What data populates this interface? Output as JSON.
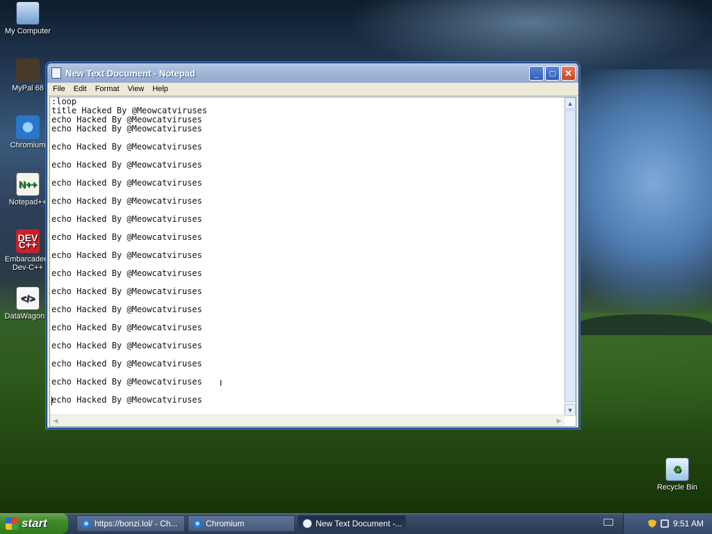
{
  "desktop": {
    "icons": [
      {
        "label": "My Computer",
        "glyph": ""
      },
      {
        "label": "MyPal 68",
        "glyph": ""
      },
      {
        "label": "Chromium",
        "glyph": ""
      },
      {
        "label": "Notepad++",
        "glyph": "N++"
      },
      {
        "label": "Embarcadero Dev-C++",
        "glyph": "DEV C++"
      },
      {
        "label": "DataWagon...",
        "glyph": "</>"
      },
      {
        "label": "Recycle Bin",
        "glyph": ""
      }
    ]
  },
  "window": {
    "title": "New Text Document - Notepad",
    "controls": {
      "minimize": "_",
      "maximize": "□",
      "close": "✕"
    },
    "menu": [
      "File",
      "Edit",
      "Format",
      "View",
      "Help"
    ],
    "content": ":loop\ntitle Hacked By @Meowcatviruses\necho Hacked By @Meowcatviruses\necho Hacked By @Meowcatviruses\n\necho Hacked By @Meowcatviruses\n\necho Hacked By @Meowcatviruses\n\necho Hacked By @Meowcatviruses\n\necho Hacked By @Meowcatviruses\n\necho Hacked By @Meowcatviruses\n\necho Hacked By @Meowcatviruses\n\necho Hacked By @Meowcatviruses\n\necho Hacked By @Meowcatviruses\n\necho Hacked By @Meowcatviruses\n\necho Hacked By @Meowcatviruses\n\necho Hacked By @Meowcatviruses\n\necho Hacked By @Meowcatviruses\n\necho Hacked By @Meowcatviruses\n\necho Hacked By @Meowcatviruses\n\necho Hacked By @Meowcatviruses\n"
  },
  "taskbar": {
    "start_label": "start",
    "tasks": [
      {
        "label": "https://bonzi.lol/ - Ch...",
        "icon": "chrome-icon"
      },
      {
        "label": "Chromium",
        "icon": "chrome-icon"
      },
      {
        "label": "New Text Document -...",
        "icon": "notepad-icon",
        "active": true
      }
    ],
    "clock": "9:51 AM"
  }
}
